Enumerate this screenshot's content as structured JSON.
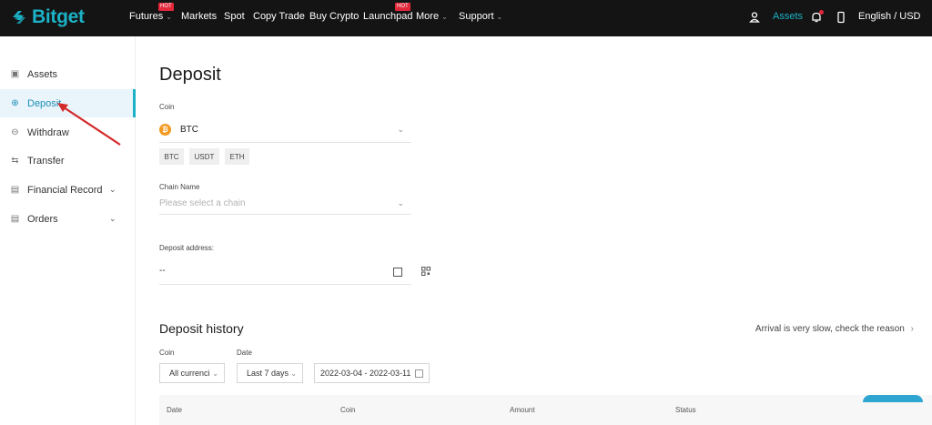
{
  "brand": {
    "name": "Bitget",
    "accent": "#1bb1c6"
  },
  "nav": {
    "items": [
      {
        "label": "Futures",
        "hot": "HOT",
        "dropdown": true
      },
      {
        "label": "Markets"
      },
      {
        "label": "Spot"
      },
      {
        "label": "Copy Trade"
      },
      {
        "label": "Buy Crypto"
      },
      {
        "label": "Launchpad",
        "hot": "HOT"
      },
      {
        "label": "More",
        "dropdown": true
      },
      {
        "label": "Support",
        "dropdown": true
      }
    ],
    "right": {
      "assets": "Assets",
      "language": "English / USD"
    }
  },
  "sidebar": {
    "items": [
      {
        "label": "Assets",
        "icon": "wallet-icon"
      },
      {
        "label": "Deposit",
        "icon": "deposit-icon",
        "active": true
      },
      {
        "label": "Withdraw",
        "icon": "withdraw-icon"
      },
      {
        "label": "Transfer",
        "icon": "transfer-icon"
      },
      {
        "label": "Financial Record",
        "icon": "record-icon",
        "expandable": true
      },
      {
        "label": "Orders",
        "icon": "orders-icon",
        "expandable": true
      }
    ]
  },
  "deposit": {
    "title": "Deposit",
    "coin_label": "Coin",
    "coin_value": "BTC",
    "quick_coins": [
      "BTC",
      "USDT",
      "ETH"
    ],
    "chain_label": "Chain Name",
    "chain_placeholder": "Please select a chain",
    "address_label": "Deposit address:",
    "address_value": "--"
  },
  "history": {
    "title": "Deposit history",
    "arrival_link": "Arrival is very slow, check the reason",
    "coin_filter_label": "Coin",
    "coin_filter_value": "All currenci",
    "date_filter_label": "Date",
    "date_filter_value": "Last 7 days",
    "date_range": "2022-03-04  -  2022-03-11",
    "columns": [
      "Date",
      "Coin",
      "Amount",
      "Status"
    ]
  }
}
